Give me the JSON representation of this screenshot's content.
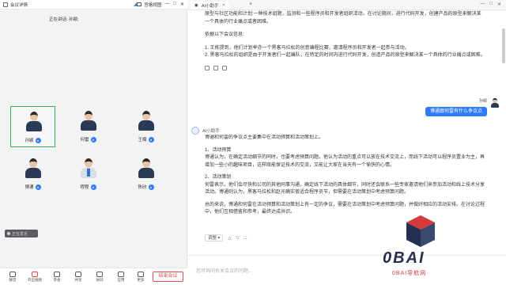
{
  "meeting": {
    "window_title": "会议详情",
    "view_mode": "宫格视图",
    "speaking_text": "正在讲话: 孙颖;",
    "participants": [
      {
        "name": "孙颖",
        "active": true
      },
      {
        "name": "何雷",
        "active": false
      },
      {
        "name": "王楠",
        "active": false
      },
      {
        "name": "博通",
        "active": false
      },
      {
        "name": "程程",
        "active": false
      },
      {
        "name": "陈欣",
        "active": false
      }
    ],
    "toolbar": {
      "items": [
        {
          "label": "静音",
          "icon": "mic-icon"
        },
        {
          "label": "开启视频",
          "icon": "video-icon"
        },
        {
          "label": "参会",
          "icon": "participants-icon"
        },
        {
          "label": "共享",
          "icon": "share-icon"
        },
        {
          "label": "协同",
          "icon": "collab-icon"
        },
        {
          "label": "应用",
          "icon": "apps-icon"
        },
        {
          "label": "更多",
          "icon": "more-icon"
        }
      ],
      "end_label": "结束会议"
    },
    "tip": "正在发言"
  },
  "assistant": {
    "tab_title": "AI小助手",
    "message1": {
      "paragraphs": [
        "原型与社区功能和计划:一种技术组题，监测和一些程序员和开发者组织活动。在讨论期间，进行代码开发，创建产品的原型来解决某一个具体的行业痛点或者困难。",
        "依据以下会议信息:",
        "1. 王栋提到，他们计划举办一个黑客马拉松的创意编程比赛，邀请程序员和开发者一起参与活动。",
        "2. 黑客马拉松的组织是由于开发者们一起编队，在特定的时间内进行代码开发，创造产品的原型来解决某一个具体的行业痛点或困难。"
      ]
    },
    "user": {
      "name": "孙颖",
      "question": "博通跟何雷有什么争议点"
    },
    "ai_label": "AI小助手",
    "message2": {
      "paragraphs": [
        "博通和何雷的争议点主要集中在活动预算和活动策划上。",
        "1、活动预算\n博通认为，在确定活动细节的同时，也要考虑预算问题。他认为活动的重点可以放在技术交流上，而线下活动可以程序员置业为主，再增加一些小的趣味项目，这样既能保证技术的交流，又能让大家在当天有一个愉快的心情。",
        "2、活动策划\n何雷表示，他们会尽快和公司的其他同事沟通，确定线下活动的具体细节，同时还会联系一些专家邀请他们来参加活动和线上技术分享活动。博通则认为，黑客马拉松和赵光确实很适合程序员节，但需要在活动策划中考虑预算问题。",
        "总的来说，博通和何雷在活动预算和活动策划上有一定的争议，需要在活动策划中考虑预算问题，并做好相应的活动安排。在讨论过程中，他们互相借鉴和参考，最终达成共识。"
      ]
    },
    "footer_dropdown": "调整",
    "input_placeholder": "您可询问有关会议的问题..."
  },
  "watermark": {
    "title": "0BAI",
    "subtitle": "0BAI导航网"
  }
}
